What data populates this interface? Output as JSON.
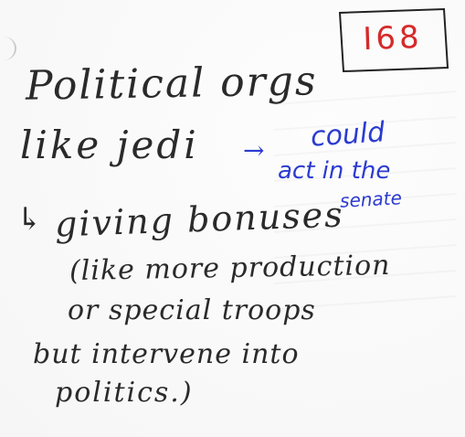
{
  "note": {
    "label": "I68",
    "lines": [
      "Political orgs",
      "like jedi",
      "could",
      "act in the",
      "senate",
      "giving bonuses",
      "(like more production",
      "or special troops",
      "but intervene into",
      "politics.)"
    ],
    "arrows": [
      "→",
      "↳"
    ]
  },
  "colors": {
    "ink": "#2a2a2a",
    "blue_ink": "#2b3bd0",
    "stamp_red": "#d52a2a"
  }
}
